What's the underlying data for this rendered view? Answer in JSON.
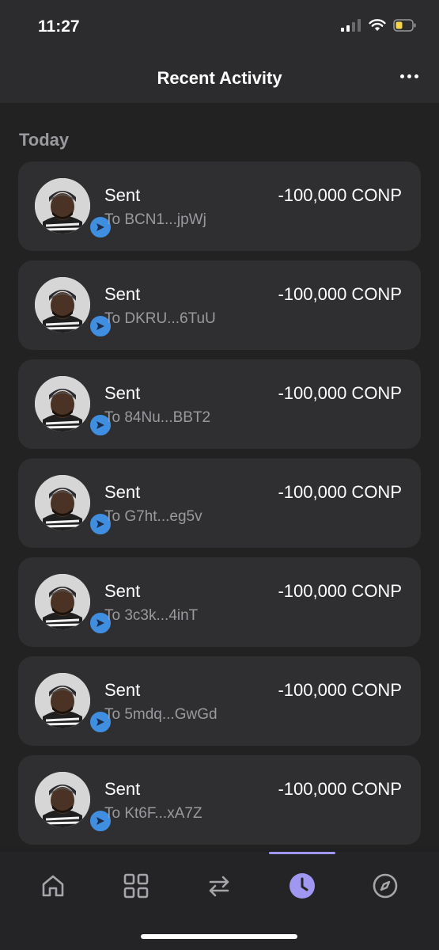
{
  "status_bar": {
    "time": "11:27"
  },
  "header": {
    "title": "Recent Activity",
    "more_icon": "more-horizontal-icon"
  },
  "section": {
    "label": "Today"
  },
  "colors": {
    "accent": "#9f97f0",
    "badge": "#3f8ee0",
    "card": "#2f2f31",
    "background": "#222223"
  },
  "transactions": [
    {
      "title": "Sent",
      "to": "To BCN1...jpWj",
      "amount": "-100,000 CONP"
    },
    {
      "title": "Sent",
      "to": "To DKRU...6TuU",
      "amount": "-100,000 CONP"
    },
    {
      "title": "Sent",
      "to": "To 84Nu...BBT2",
      "amount": "-100,000 CONP"
    },
    {
      "title": "Sent",
      "to": "To G7ht...eg5v",
      "amount": "-100,000 CONP"
    },
    {
      "title": "Sent",
      "to": "To 3c3k...4inT",
      "amount": "-100,000 CONP"
    },
    {
      "title": "Sent",
      "to": "To 5mdq...GwGd",
      "amount": "-100,000 CONP"
    },
    {
      "title": "Sent",
      "to": "To Kt6F...xA7Z",
      "amount": "-100,000 CONP"
    }
  ],
  "tabbar": {
    "tabs": [
      {
        "icon": "home-icon",
        "active": false
      },
      {
        "icon": "grid-icon",
        "active": false
      },
      {
        "icon": "swap-icon",
        "active": false
      },
      {
        "icon": "clock-icon",
        "active": true
      },
      {
        "icon": "compass-icon",
        "active": false
      }
    ]
  }
}
